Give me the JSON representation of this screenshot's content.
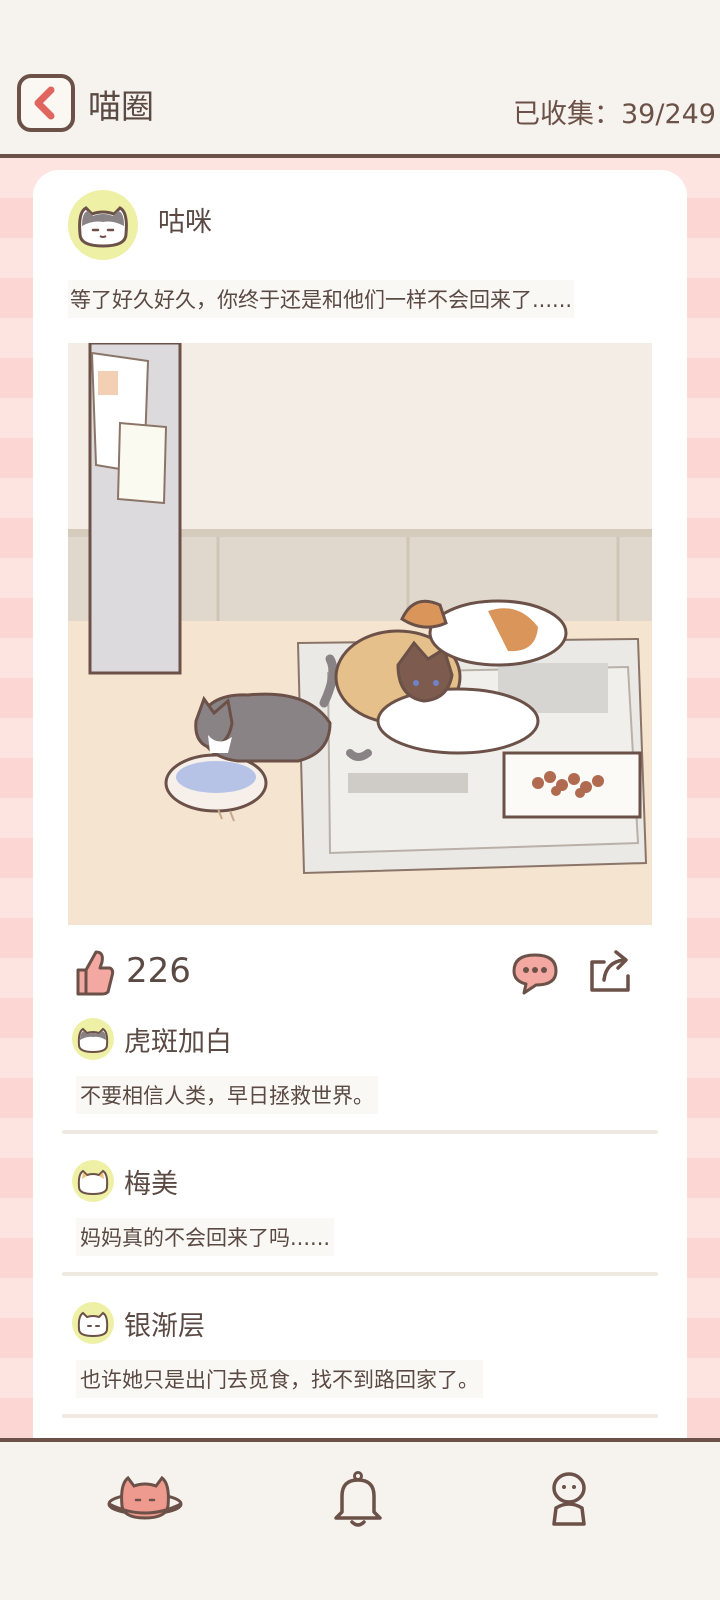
{
  "header": {
    "title": "喵圈",
    "counter_label": "已收集：",
    "counter_value": "39/249"
  },
  "post": {
    "author": "咕咪",
    "text": "等了好久好久，你终于还是和他们一样不会回来了......",
    "like_count": "226"
  },
  "comments": [
    {
      "name": "虎斑加白",
      "text": "不要相信人类，早日拯救世界。"
    },
    {
      "name": "梅美",
      "text": "妈妈真的不会回来了吗......"
    },
    {
      "name": "银渐层",
      "text": "也许她只是出门去觅食，找不到路回家了。"
    }
  ],
  "tabs": [
    {
      "icon": "cat-planet-icon",
      "active": true
    },
    {
      "icon": "bell-icon",
      "active": false
    },
    {
      "icon": "profile-icon",
      "active": false
    }
  ],
  "colors": {
    "brown": "#6b5148",
    "accent_red": "#e0655e",
    "pink_stripe": "#fde4e1",
    "avatar_bg": "#eef0a5"
  }
}
